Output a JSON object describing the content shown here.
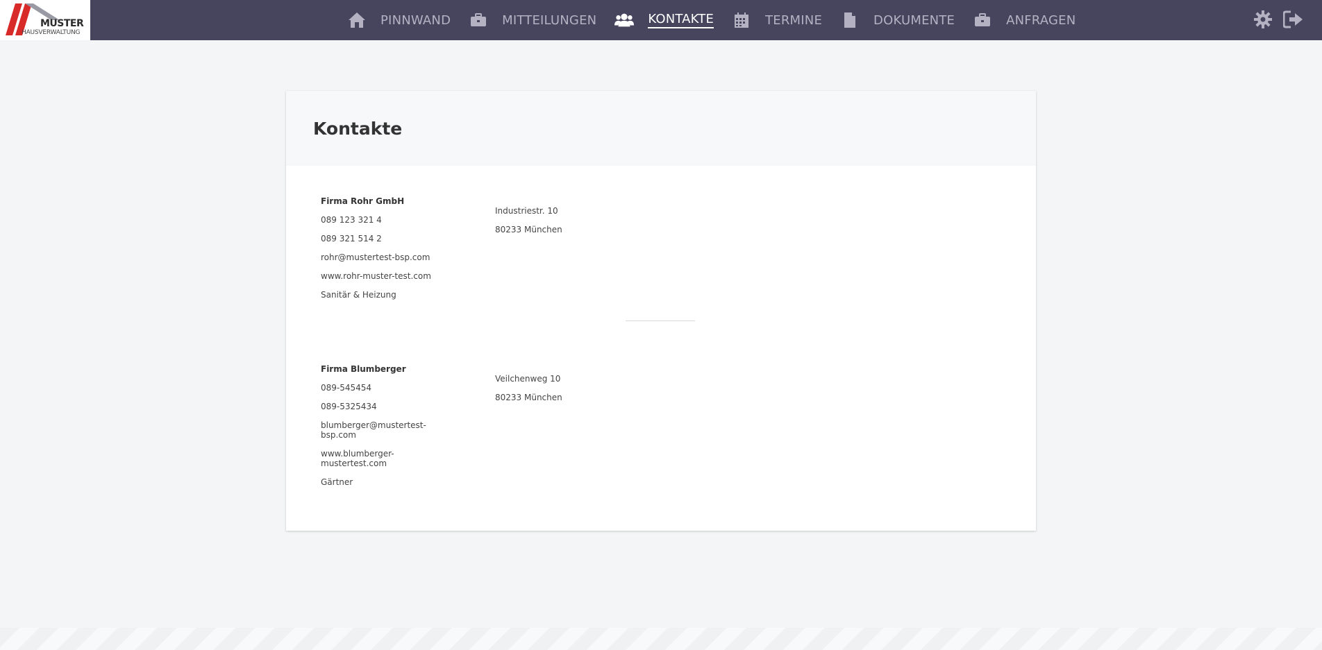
{
  "logo": {
    "word": "MUSTER",
    "sub": "HAUSVERWALTUNG"
  },
  "nav": [
    {
      "label": "PINNWAND",
      "icon": "home-icon"
    },
    {
      "label": "MITTEILUNGEN",
      "icon": "briefcase-icon"
    },
    {
      "label": "KONTAKTE",
      "icon": "users-icon",
      "active": true
    },
    {
      "label": "TERMINE",
      "icon": "calendar-icon"
    },
    {
      "label": "DOKUMENTE",
      "icon": "document-icon"
    },
    {
      "label": "ANFRAGEN",
      "icon": "briefcase-icon"
    }
  ],
  "page": {
    "title": "Kontakte"
  },
  "contacts": [
    {
      "name": "Firma Rohr GmbH",
      "phone1": "089 123 321 4",
      "phone2": "089 321 514 2",
      "email": "rohr@mustertest-bsp.com",
      "web": "www.rohr-muster-test.com",
      "category": "Sanitär & Heizung",
      "street": "Industriestr. 10",
      "city": "80233 München"
    },
    {
      "name": "Firma Blumberger",
      "phone1": "089-545454",
      "phone2": "089-5325434",
      "email": "blumberger@mustertest-bsp.com",
      "web": "www.blumberger-mustertest.com",
      "category": "Gärtner",
      "street": "Veilchenweg 10",
      "city": "80233 München"
    }
  ],
  "colors": {
    "topbar": "#47445e",
    "nav_text": "#b4b2c2",
    "active": "#ffffff",
    "logo_red": "#d92a2a"
  }
}
